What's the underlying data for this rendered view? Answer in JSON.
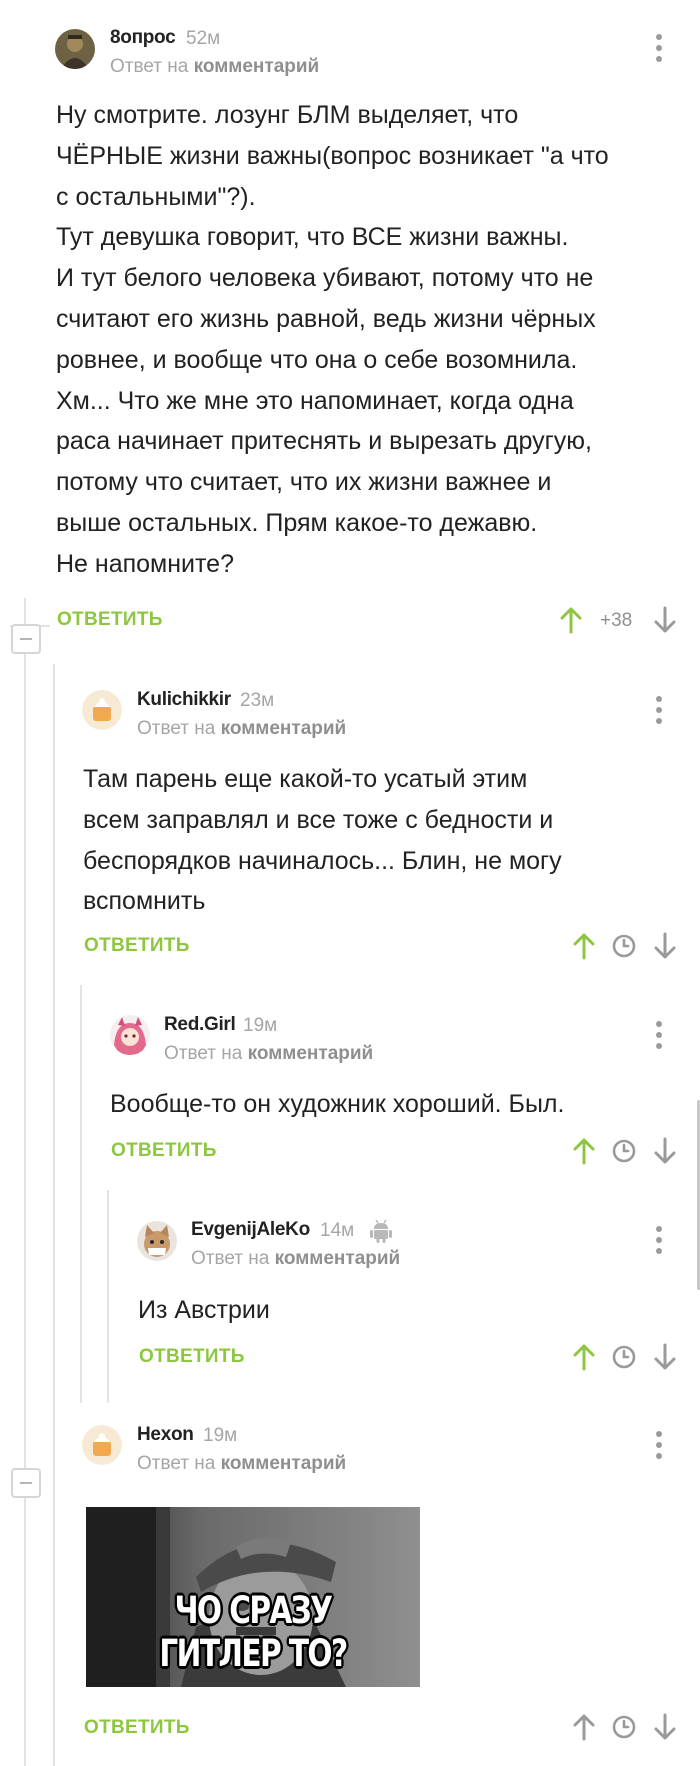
{
  "comments": [
    {
      "author": "8опрос",
      "time": "52м",
      "reply_prefix": "Ответ на",
      "reply_link": "комментарий",
      "lines": [
        "Ну смотрите. лозунг БЛМ выделяет, что",
        "ЧЁРНЫЕ жизни важны(вопрос возникает \"а что",
        "с остальными\"?).",
        "Тут девушка говорит, что ВСЕ жизни важны.",
        "И тут белого человека убивают, потому что не",
        "считают его жизнь равной, ведь жизни чёрных",
        "ровнее, и вообще что она о себе возомнила.",
        "Хм... Что же мне это напоминает, когда одна",
        "раса начинает притеснять и вырезать другую,",
        "потому что считает, что их жизни важнее и",
        "выше остальных. Прям какое-то дежавю.",
        "Не напомните?"
      ],
      "reply_label": "ОТВЕТИТЬ",
      "rating": "+38"
    },
    {
      "author": "Kulichikkir",
      "time": "23м",
      "reply_prefix": "Ответ на",
      "reply_link": "комментарий",
      "lines": [
        "Там парень еще какой-то усатый этим",
        "всем заправлял и все тоже с бедности и",
        "беспорядков начиналось... Блин, не могу",
        "вспомнить"
      ],
      "reply_label": "ОТВЕТИТЬ"
    },
    {
      "author": "Red.Girl",
      "time": "19м",
      "reply_prefix": "Ответ на",
      "reply_link": "комментарий",
      "lines": [
        "Вообще-то он художник хороший. Был."
      ],
      "reply_label": "ОТВЕТИТЬ"
    },
    {
      "author": "EvgenijAleKo",
      "time": "14м",
      "device_icon": "android-icon",
      "reply_prefix": "Ответ на",
      "reply_link": "комментарий",
      "lines": [
        "Из Австрии"
      ],
      "reply_label": "ОТВЕТИТЬ"
    },
    {
      "author": "Hexon",
      "time": "19м",
      "reply_prefix": "Ответ на",
      "reply_link": "комментарий",
      "image_caption": "ЧО СРАЗУ ГИТЛЕР ТО?",
      "reply_label": "ОТВЕТИТЬ"
    }
  ],
  "colors": {
    "accent_green": "#8dc63f",
    "vote_up_active": "#8dc63f",
    "vote_neutral": "#9a9a9a",
    "meta_gray": "#a5a5a5",
    "thread_line": "#e3e3e3"
  },
  "icons": [
    "more-vertical-icon",
    "arrow-up-icon",
    "arrow-down-icon",
    "clock-icon",
    "android-icon",
    "collapse-minus-icon"
  ]
}
